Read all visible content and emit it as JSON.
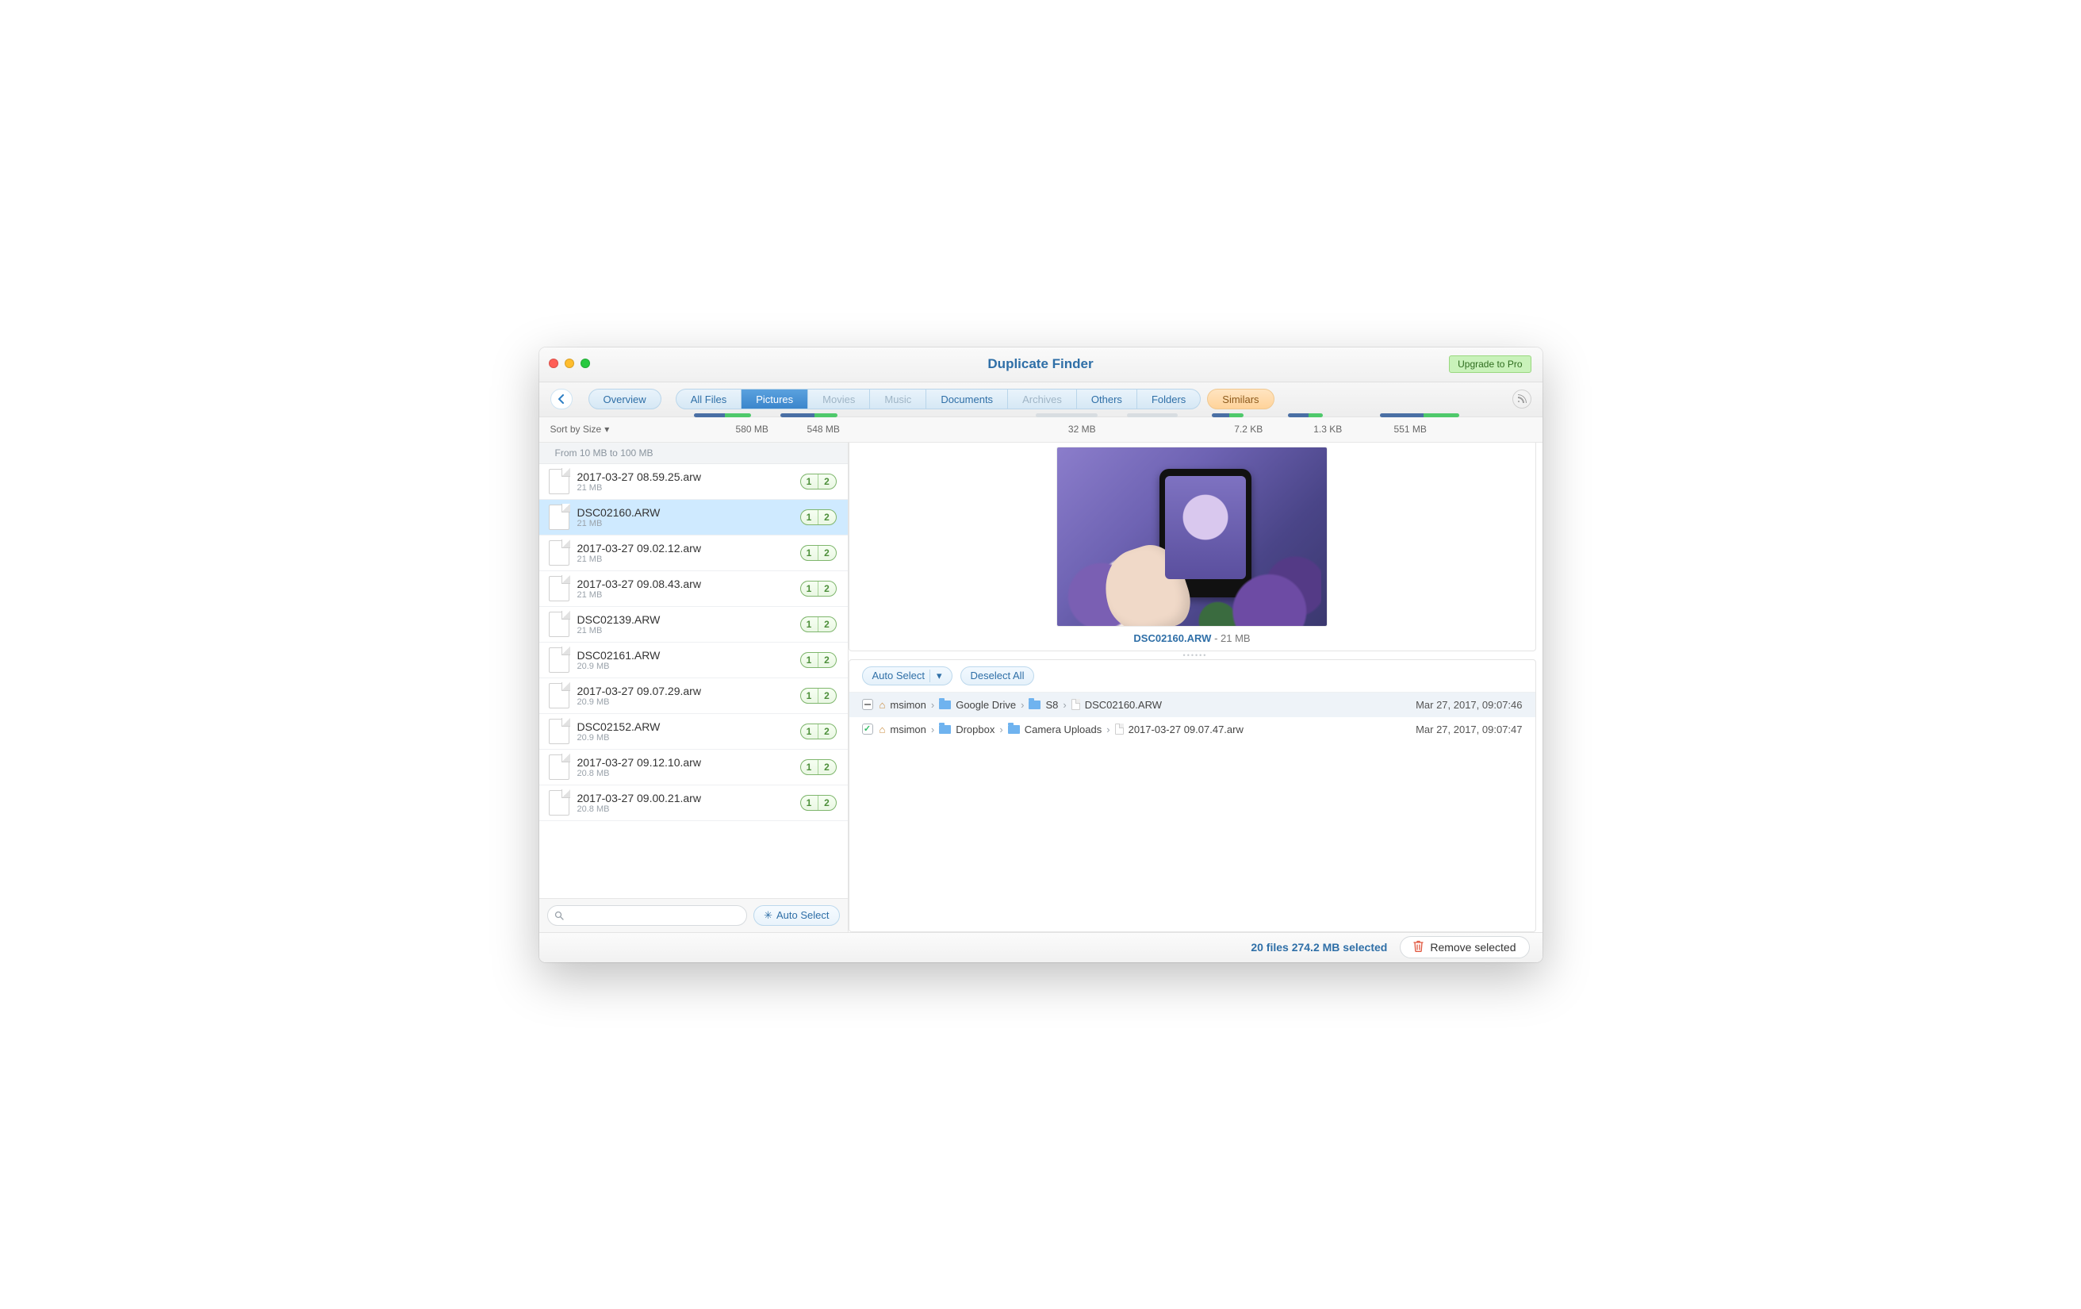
{
  "window": {
    "title": "Duplicate Finder",
    "upgrade_label": "Upgrade to Pro"
  },
  "tabs": {
    "overview": "Overview",
    "items": [
      {
        "label": "All Files",
        "size": "580 MB",
        "active": false,
        "disabled": false
      },
      {
        "label": "Pictures",
        "size": "548 MB",
        "active": true,
        "disabled": false
      },
      {
        "label": "Movies",
        "size": "",
        "active": false,
        "disabled": true
      },
      {
        "label": "Music",
        "size": "",
        "active": false,
        "disabled": true
      },
      {
        "label": "Documents",
        "size": "32 MB",
        "active": false,
        "disabled": false
      },
      {
        "label": "Archives",
        "size": "",
        "active": false,
        "disabled": true
      },
      {
        "label": "Others",
        "size": "7.2 KB",
        "active": false,
        "disabled": false
      },
      {
        "label": "Folders",
        "size": "1.3 KB",
        "active": false,
        "disabled": false
      }
    ],
    "similars": {
      "label": "Similars",
      "size": "551 MB"
    }
  },
  "sort_label": "Sort by Size",
  "group_header": "From 10 MB to 100 MB",
  "files": [
    {
      "name": "2017-03-27 08.59.25.arw",
      "size": "21 MB",
      "count1": "1",
      "count2": "2",
      "selected": false
    },
    {
      "name": "DSC02160.ARW",
      "size": "21 MB",
      "count1": "1",
      "count2": "2",
      "selected": true
    },
    {
      "name": "2017-03-27 09.02.12.arw",
      "size": "21 MB",
      "count1": "1",
      "count2": "2",
      "selected": false
    },
    {
      "name": "2017-03-27 09.08.43.arw",
      "size": "21 MB",
      "count1": "1",
      "count2": "2",
      "selected": false
    },
    {
      "name": "DSC02139.ARW",
      "size": "21 MB",
      "count1": "1",
      "count2": "2",
      "selected": false
    },
    {
      "name": "DSC02161.ARW",
      "size": "20.9 MB",
      "count1": "1",
      "count2": "2",
      "selected": false
    },
    {
      "name": "2017-03-27 09.07.29.arw",
      "size": "20.9 MB",
      "count1": "1",
      "count2": "2",
      "selected": false
    },
    {
      "name": "DSC02152.ARW",
      "size": "20.9 MB",
      "count1": "1",
      "count2": "2",
      "selected": false
    },
    {
      "name": "2017-03-27 09.12.10.arw",
      "size": "20.8 MB",
      "count1": "1",
      "count2": "2",
      "selected": false
    },
    {
      "name": "2017-03-27 09.00.21.arw",
      "size": "20.8 MB",
      "count1": "1",
      "count2": "2",
      "selected": false
    }
  ],
  "sidebar_footer": {
    "search_placeholder": "",
    "auto_select": "Auto Select"
  },
  "preview": {
    "filename": "DSC02160.ARW",
    "size": "21 MB"
  },
  "dup_toolbar": {
    "auto_select": "Auto Select",
    "deselect_all": "Deselect All"
  },
  "dup_rows": [
    {
      "checked": "minus",
      "crumbs": [
        "msimon",
        "Google Drive",
        "S8",
        "DSC02160.ARW"
      ],
      "date": "Mar 27, 2017, 09:07:46",
      "alt": true
    },
    {
      "checked": "checked",
      "crumbs": [
        "msimon",
        "Dropbox",
        "Camera Uploads",
        "2017-03-27 09.07.47.arw"
      ],
      "date": "Mar 27, 2017, 09:07:47",
      "alt": false
    }
  ],
  "bottom": {
    "selection": "20 files 274.2 MB selected",
    "remove": "Remove selected"
  }
}
